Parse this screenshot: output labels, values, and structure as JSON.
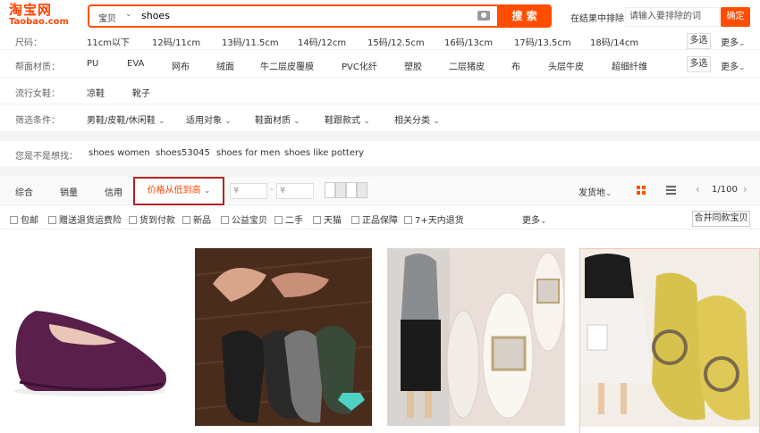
{
  "logo": {
    "cn": "淘宝网",
    "en": "Taobao.com"
  },
  "search": {
    "scope": "宝贝",
    "query": "shoes",
    "button": "搜 索"
  },
  "exclude": {
    "label": "在结果中排除",
    "placeholder": "请输入要排除的词",
    "button": "确定"
  },
  "filters": [
    {
      "label": "尺码：",
      "items": [
        "11cm以下",
        "12码/11cm",
        "13码/11.5cm",
        "14码/12cm",
        "15码/12.5cm",
        "16码/13cm",
        "17码/13.5cm",
        "18码/14cm"
      ],
      "multi": "多选",
      "more": "更多"
    },
    {
      "label": "帮面材质：",
      "items": [
        "PU",
        "EVA",
        "网布",
        "绒面",
        "牛二层皮覆膜",
        "PVC化纤",
        "塑胶",
        "二层猪皮",
        "布",
        "头层牛皮",
        "超细纤维"
      ],
      "multi": "多选",
      "more": "更多"
    },
    {
      "label": "流行女鞋：",
      "items": [
        "凉鞋",
        "靴子"
      ]
    },
    {
      "label": "筛选条件：",
      "items": [
        "男鞋/皮鞋/休闲鞋",
        "适用对象",
        "鞋面材质",
        "鞋跟款式",
        "相关分类"
      ]
    }
  ],
  "suggest": {
    "label": "您是不是想找：",
    "items": [
      "shoes women",
      "shoes53045",
      "shoes for men",
      "shoes like pottery"
    ]
  },
  "sort": {
    "items": [
      "综合",
      "销量",
      "信用"
    ],
    "price": "价格从低到高",
    "min_placeholder": "¥",
    "max_placeholder": "¥",
    "ship_from": "发货地",
    "pager": "1/100"
  },
  "checks": [
    "包邮",
    "赠送退货运费险",
    "货到付款",
    "新品",
    "公益宝贝",
    "二手",
    "天猫",
    "正品保障",
    "7+天内退货"
  ],
  "checks_more": "更多",
  "merge_button": "合并同款宝贝",
  "colors": {
    "accent": "#ff4400",
    "highlight_border": "#b22222"
  }
}
